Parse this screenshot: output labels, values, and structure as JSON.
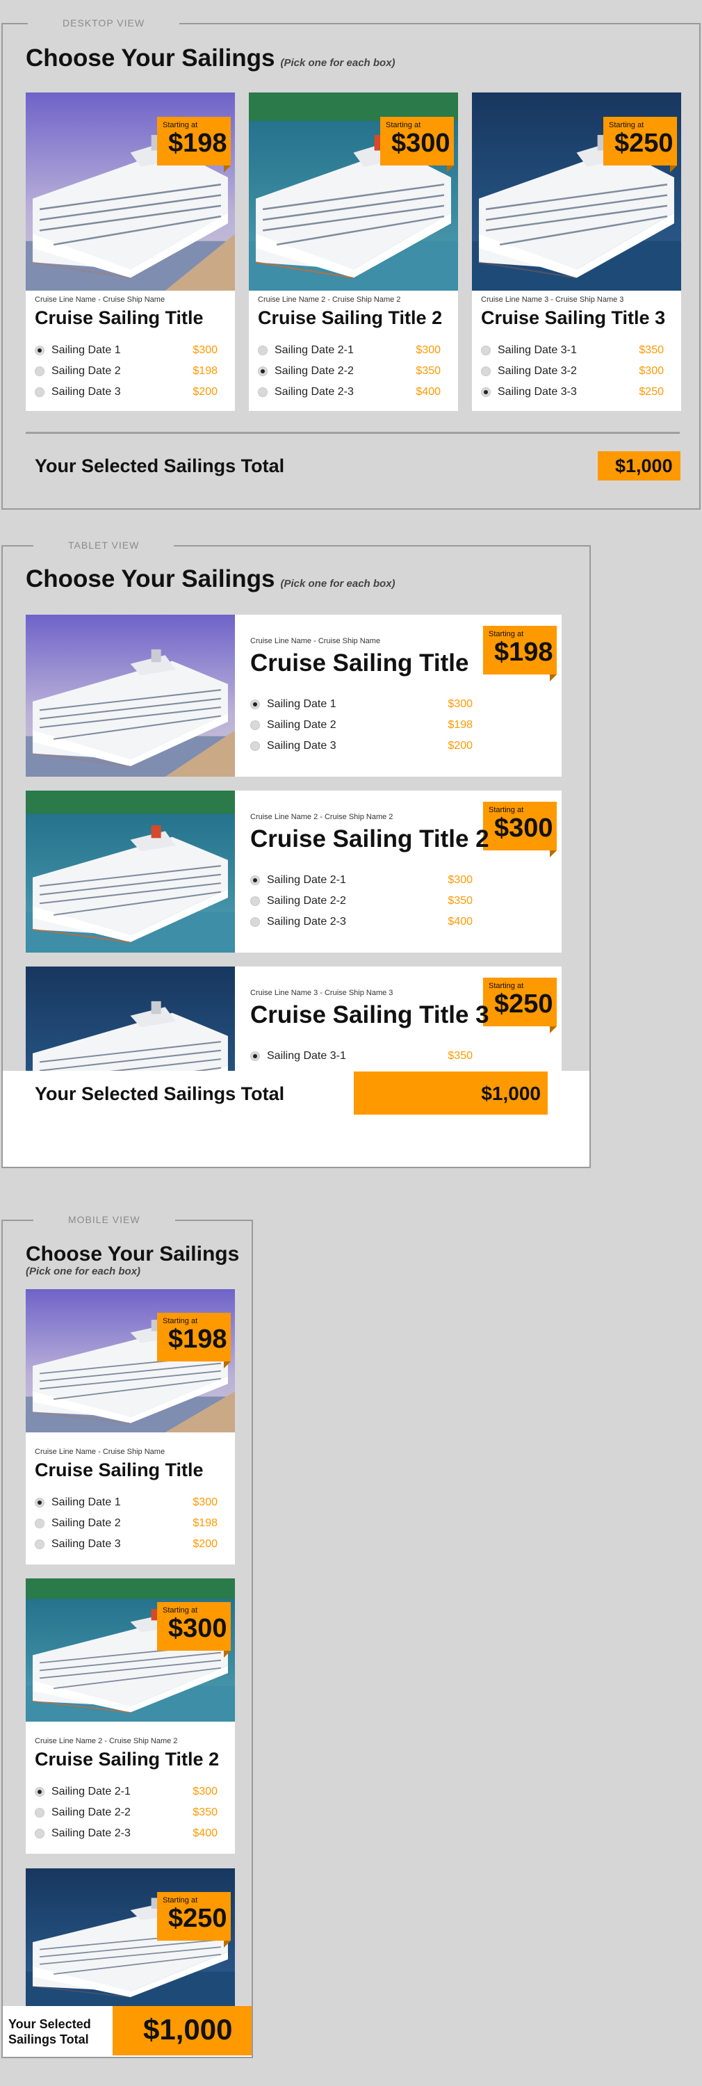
{
  "colors": {
    "accent": "#ff9900",
    "background": "#d6d6d6",
    "card": "#ffffff"
  },
  "views": {
    "desktop": {
      "label": "DESKTOP VIEW"
    },
    "tablet": {
      "label": "TABLET VIEW"
    },
    "mobile": {
      "label": "MOBILE VIEW"
    }
  },
  "heading": {
    "title": "Choose Your Sailings",
    "subtitle": "(Pick one for each box)"
  },
  "starting_at": "Starting at",
  "cruises": [
    {
      "line": "Cruise Line Name - Cruise Ship Name",
      "title": "Cruise Sailing Title",
      "price": "$198",
      "image_icon": "cruise-ship-image",
      "dates": [
        {
          "label": "Sailing Date 1",
          "price": "$300",
          "selected": true
        },
        {
          "label": "Sailing Date 2",
          "price": "$198",
          "selected": false
        },
        {
          "label": "Sailing Date 3",
          "price": "$200",
          "selected": false
        }
      ]
    },
    {
      "line": "Cruise Line Name 2 - Cruise Ship Name 2",
      "title": "Cruise Sailing Title 2",
      "price": "$300",
      "image_icon": "cruise-ship-image",
      "dates": [
        {
          "label": "Sailing Date 2-1",
          "price": "$300",
          "selected": false
        },
        {
          "label": "Sailing Date 2-2",
          "price": "$350",
          "selected": true
        },
        {
          "label": "Sailing Date 2-3",
          "price": "$400",
          "selected": false
        }
      ]
    },
    {
      "line": "Cruise Line Name 3 - Cruise Ship Name 3",
      "title": "Cruise Sailing Title 3",
      "price": "$250",
      "image_icon": "cruise-ship-image",
      "dates": [
        {
          "label": "Sailing Date 3-1",
          "price": "$350",
          "selected": false
        },
        {
          "label": "Sailing Date 3-2",
          "price": "$300",
          "selected": false
        },
        {
          "label": "Sailing Date 3-3",
          "price": "$250",
          "selected": true
        }
      ]
    }
  ],
  "tablet_selection": {
    "row_1": 0,
    "row_2": 0,
    "row_3": 0
  },
  "mobile_selection": {
    "row_1": 0,
    "row_2": 0
  },
  "total": {
    "label": "Your Selected Sailings Total",
    "mobile_label": "Your Selected Sailings Total",
    "value": "$1,000"
  }
}
